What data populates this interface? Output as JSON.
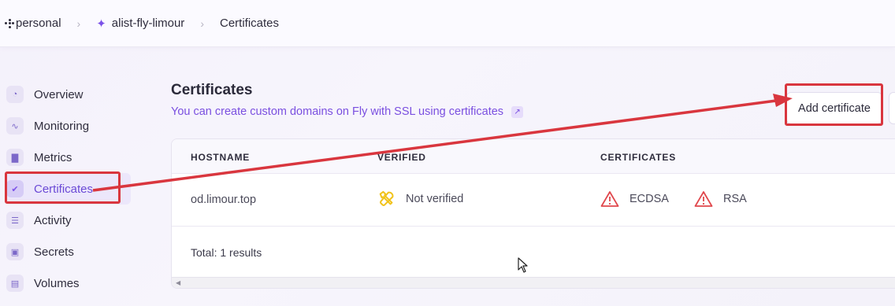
{
  "breadcrumb": {
    "org": "personal",
    "app": "alist-fly-limour",
    "page": "Certificates"
  },
  "sidebar": {
    "items": [
      {
        "label": "Overview",
        "icon": "overview-icon",
        "active": false
      },
      {
        "label": "Monitoring",
        "icon": "monitoring-icon",
        "active": false
      },
      {
        "label": "Metrics",
        "icon": "metrics-icon",
        "active": false
      },
      {
        "label": "Certificates",
        "icon": "certificates-icon",
        "active": true
      },
      {
        "label": "Activity",
        "icon": "activity-icon",
        "active": false
      },
      {
        "label": "Secrets",
        "icon": "secrets-icon",
        "active": false
      },
      {
        "label": "Volumes",
        "icon": "volumes-icon",
        "active": false
      }
    ]
  },
  "main": {
    "title": "Certificates",
    "subtitle": "You can create custom domains on Fly with SSL using certificates",
    "add_button": "Add certificate"
  },
  "table": {
    "headers": [
      "HOSTNAME",
      "VERIFIED",
      "CERTIFICATES"
    ],
    "rows": [
      {
        "hostname": "od.limour.top",
        "verified": "Not verified",
        "certificates": [
          "ECDSA",
          "RSA"
        ]
      }
    ],
    "total": "Total: 1 results"
  },
  "colors": {
    "accent": "#7b52e8",
    "annotation_red": "#d9363e",
    "warning_red": "#e0474c",
    "wrench_yellow": "#f1c31c"
  }
}
